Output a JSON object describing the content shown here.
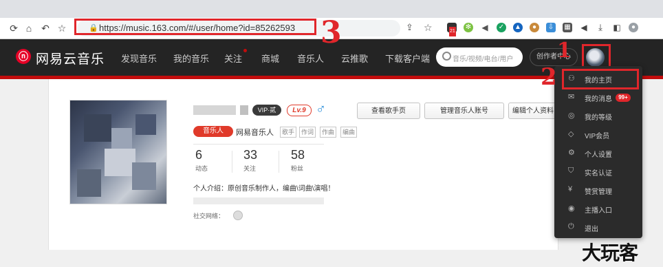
{
  "browser": {
    "url": "https://music.163.com/#/user/home?id=85262593",
    "nav_icons": [
      "reload-icon",
      "home-icon",
      "back-icon",
      "bookmark-star-icon"
    ],
    "toolbar_icons": [
      "share-icon",
      "star-icon",
      "calendar-extension-icon",
      "green-extension-icon",
      "sound-icon",
      "green-circle-extension-icon",
      "blue-extension-icon",
      "cookie-extension-icon",
      "download-extension-icon",
      "grid-extension-icon",
      "mute-icon",
      "download-icon",
      "sidebar-icon",
      "profile-icon"
    ],
    "calendar_badge": "21"
  },
  "site": {
    "logo_text": "网易云音乐",
    "nav": [
      "发现音乐",
      "我的音乐",
      "关注",
      "商城",
      "音乐人",
      "云推歌",
      "下载客户端"
    ],
    "search_placeholder": "音乐/视频/电台/用户",
    "creator_button": "创作者中心"
  },
  "profile": {
    "vip_badge": "VIP·贰",
    "level": "Lv.9",
    "gender_icon": "male-icon",
    "buttons": [
      "查看歌手页",
      "管理音乐人账号",
      "编辑个人资料"
    ],
    "musician_tag": "音乐人",
    "musician_name": "网易音乐人",
    "roles": [
      "歌手",
      "作词",
      "作曲",
      "编曲"
    ],
    "stats": [
      {
        "value": "6",
        "label": "动态"
      },
      {
        "value": "33",
        "label": "关注"
      },
      {
        "value": "58",
        "label": "粉丝"
      }
    ],
    "intro": "个人介绍：原创音乐制作人，编曲\\词曲\\演唱！",
    "social_label": "社交网络："
  },
  "dropdown": {
    "items": [
      {
        "icon": "user-icon",
        "label": "我的主页"
      },
      {
        "icon": "mail-icon",
        "label": "我的消息"
      },
      {
        "icon": "medal-icon",
        "label": "我的等级"
      },
      {
        "icon": "diamond-icon",
        "label": "VIP会员"
      },
      {
        "icon": "gear-icon",
        "label": "个人设置"
      },
      {
        "icon": "shield-icon",
        "label": "实名认证"
      },
      {
        "icon": "yen-icon",
        "label": "赞赏管理"
      },
      {
        "icon": "broadcast-icon",
        "label": "主播入口"
      },
      {
        "icon": "power-icon",
        "label": "退出"
      }
    ],
    "message_badge": "99+"
  },
  "annotations": {
    "marks": [
      "1",
      "2",
      "3"
    ],
    "watermark": "大玩客"
  },
  "colors": {
    "header_bg": "#242424",
    "brand_red": "#c20c0c",
    "annotation_red": "#e0262b",
    "dropdown_bg": "#2b2b2b"
  }
}
